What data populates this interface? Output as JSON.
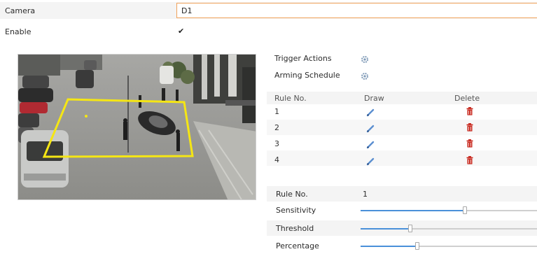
{
  "form": {
    "camera_label": "Camera",
    "camera_value": "D1",
    "enable_label": "Enable",
    "enable_checked": true,
    "enable_mark": "✔"
  },
  "actions": {
    "trigger_actions_label": "Trigger Actions",
    "arming_schedule_label": "Arming Schedule",
    "icon": "gear-icon"
  },
  "rules_table": {
    "headers": [
      "Rule No.",
      "Draw",
      "Delete"
    ],
    "rows": [
      {
        "no": "1",
        "draw_icon": "pencil-icon",
        "delete_icon": "trash-icon"
      },
      {
        "no": "2",
        "draw_icon": "pencil-icon",
        "delete_icon": "trash-icon"
      },
      {
        "no": "3",
        "draw_icon": "pencil-icon",
        "delete_icon": "trash-icon"
      },
      {
        "no": "4",
        "draw_icon": "pencil-icon",
        "delete_icon": "trash-icon"
      }
    ]
  },
  "rule_settings": {
    "rule_no_label": "Rule No.",
    "rule_no_value": "1",
    "sensitivity_label": "Sensitivity",
    "sensitivity_fraction": 0.59,
    "threshold_label": "Threshold",
    "threshold_fraction": 0.28,
    "percentage_label": "Percentage",
    "percentage_fraction": 0.32
  },
  "colors": {
    "accent": "#4a90d9",
    "zone": "#f5e614",
    "delete": "#c8281e"
  }
}
